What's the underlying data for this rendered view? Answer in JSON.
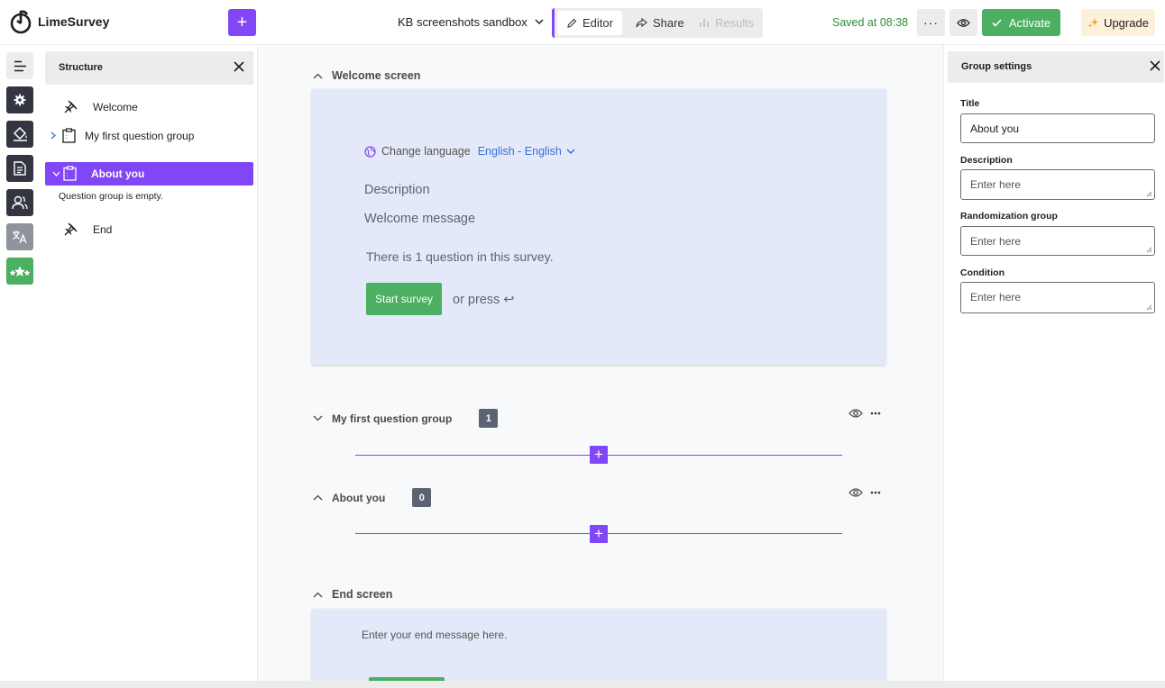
{
  "app": {
    "brand": "LimeSurvey",
    "accent_color": "#8146f6",
    "success_color": "#4caf61"
  },
  "topbar": {
    "add_label": "+",
    "survey_title": "KB screenshots sandbox",
    "modes": {
      "editor": "Editor",
      "share": "Share",
      "results": "Results"
    },
    "saved_status": "Saved at 08:38",
    "more_label": "···",
    "activate_label": "Activate",
    "upgrade_label": "Upgrade"
  },
  "rail": {
    "items": [
      "menu-icon",
      "gear-icon",
      "paint-bucket-icon",
      "document-icon",
      "users-icon",
      "translate-icon",
      "stars-icon"
    ]
  },
  "structure": {
    "title": "Structure",
    "items": {
      "welcome": "Welcome",
      "first_group": "My first question group",
      "about_you": "About you",
      "empty_note": "Question group is empty.",
      "end": "End"
    }
  },
  "canvas": {
    "welcome_section": "Welcome screen",
    "change_language_label": "Change language",
    "language_value": "English - English",
    "description": "Description",
    "welcome_message": "Welcome message",
    "question_count_text": "There is 1 question in this survey.",
    "start_button": "Start survey",
    "or_press": "or press ↩",
    "groups": [
      {
        "title": "My first question group",
        "count": "1",
        "expanded": false
      },
      {
        "title": "About you",
        "count": "0",
        "expanded": true
      }
    ],
    "end_section": "End screen",
    "end_message": "Enter your end message here."
  },
  "settings": {
    "title": "Group settings",
    "title_label": "Title",
    "title_value": "About you",
    "description_label": "Description",
    "description_placeholder": "Enter here",
    "randomization_label": "Randomization group",
    "randomization_placeholder": "Enter here",
    "condition_label": "Condition",
    "condition_placeholder": "Enter here"
  }
}
